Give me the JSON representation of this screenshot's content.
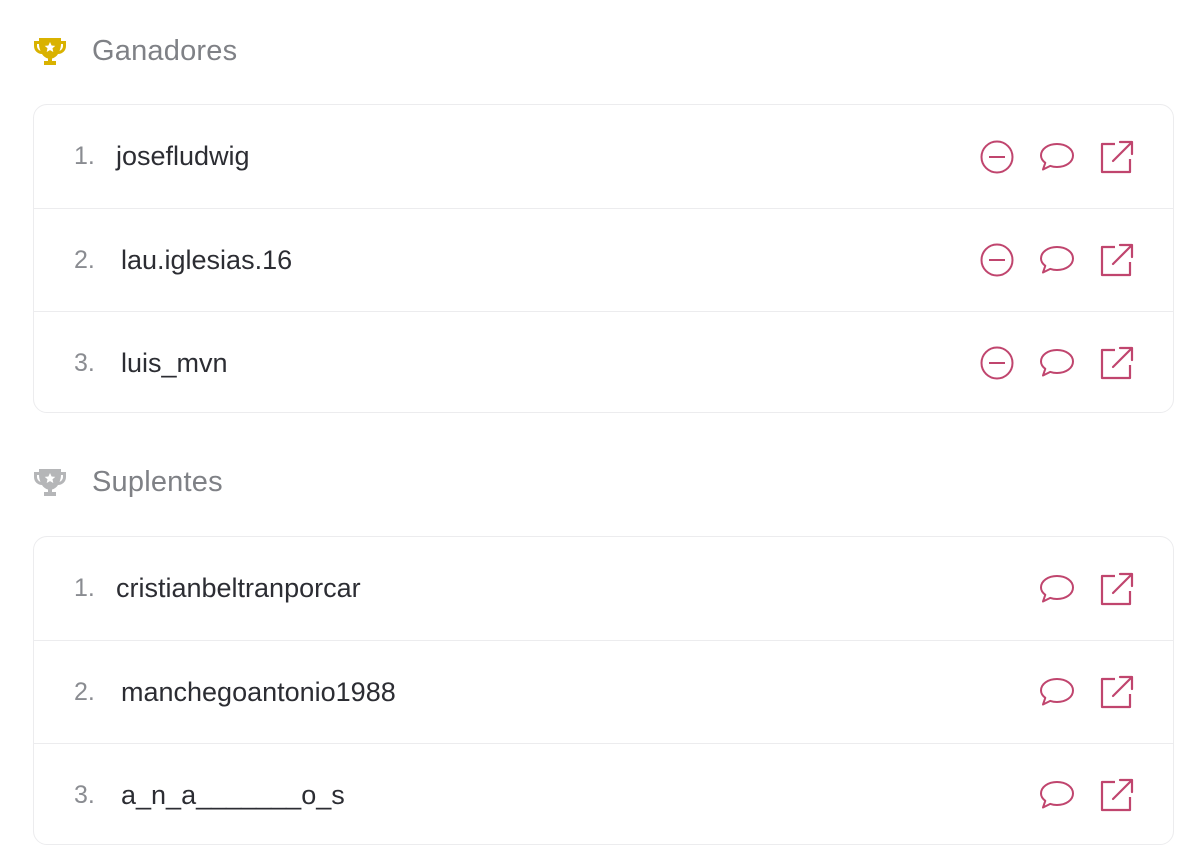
{
  "colors": {
    "accent": "#c0456e",
    "gold": "#d9b200",
    "silver": "#b5b6b8",
    "muted_text": "#7f8186",
    "body_text": "#2c2d33",
    "border": "#ececee"
  },
  "winners": {
    "title": "Ganadores",
    "icon": "trophy-gold-icon",
    "items": [
      {
        "num": "1.",
        "name": "josefludwig"
      },
      {
        "num": "2.",
        "name": "lau.iglesias.16"
      },
      {
        "num": "3.",
        "name": "luis_mvn"
      }
    ]
  },
  "substitutes": {
    "title": "Suplentes",
    "icon": "trophy-silver-icon",
    "items": [
      {
        "num": "1.",
        "name": "cristianbeltranporcar"
      },
      {
        "num": "2.",
        "name": "manchegoantonio1988"
      },
      {
        "num": "3.",
        "name": "a_n_a_______o_s"
      }
    ]
  },
  "row_actions": {
    "remove": "minus-circle-icon",
    "comment": "speech-bubble-icon",
    "open": "external-link-icon"
  }
}
